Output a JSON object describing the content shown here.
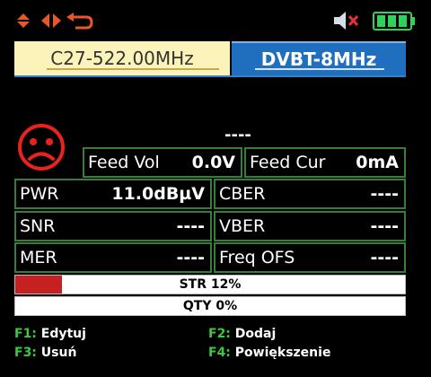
{
  "header": {
    "nav_icons": [
      "up-down-arrows-icon",
      "left-right-arrows-icon",
      "back-icon"
    ],
    "status_icons": [
      "speaker-muted-icon",
      "battery-icon"
    ],
    "accent_color": "#e8562a"
  },
  "channel": {
    "frequency": "C27-522.00MHz",
    "standard": "DVBT-8MHz"
  },
  "signal_status": "----",
  "feed": {
    "vol_label": "Feed Vol",
    "vol_value": "0.0V",
    "cur_label": "Feed Cur",
    "cur_value": "0mA"
  },
  "measurements": {
    "pwr_label": "PWR",
    "pwr_value": "11.0dBµV",
    "cber_label": "CBER",
    "cber_value": "----",
    "snr_label": "SNR",
    "snr_value": "----",
    "vber_label": "VBER",
    "vber_value": "----",
    "mer_label": "MER",
    "mer_value": "----",
    "freqofs_label": "Freq OFS",
    "freqofs_value": "----"
  },
  "bars": {
    "str_label": "STR 12%",
    "str_fraction": 0.12,
    "qty_label": "QTY 0%",
    "qty_fraction": 0.0
  },
  "function_keys": {
    "f1_key": "F1:",
    "f1_label": "Edytuj",
    "f2_key": "F2:",
    "f2_label": "Dodaj",
    "f3_key": "F3:",
    "f3_label": "Usuń",
    "f4_key": "F4:",
    "f4_label": "Powiększenie"
  }
}
